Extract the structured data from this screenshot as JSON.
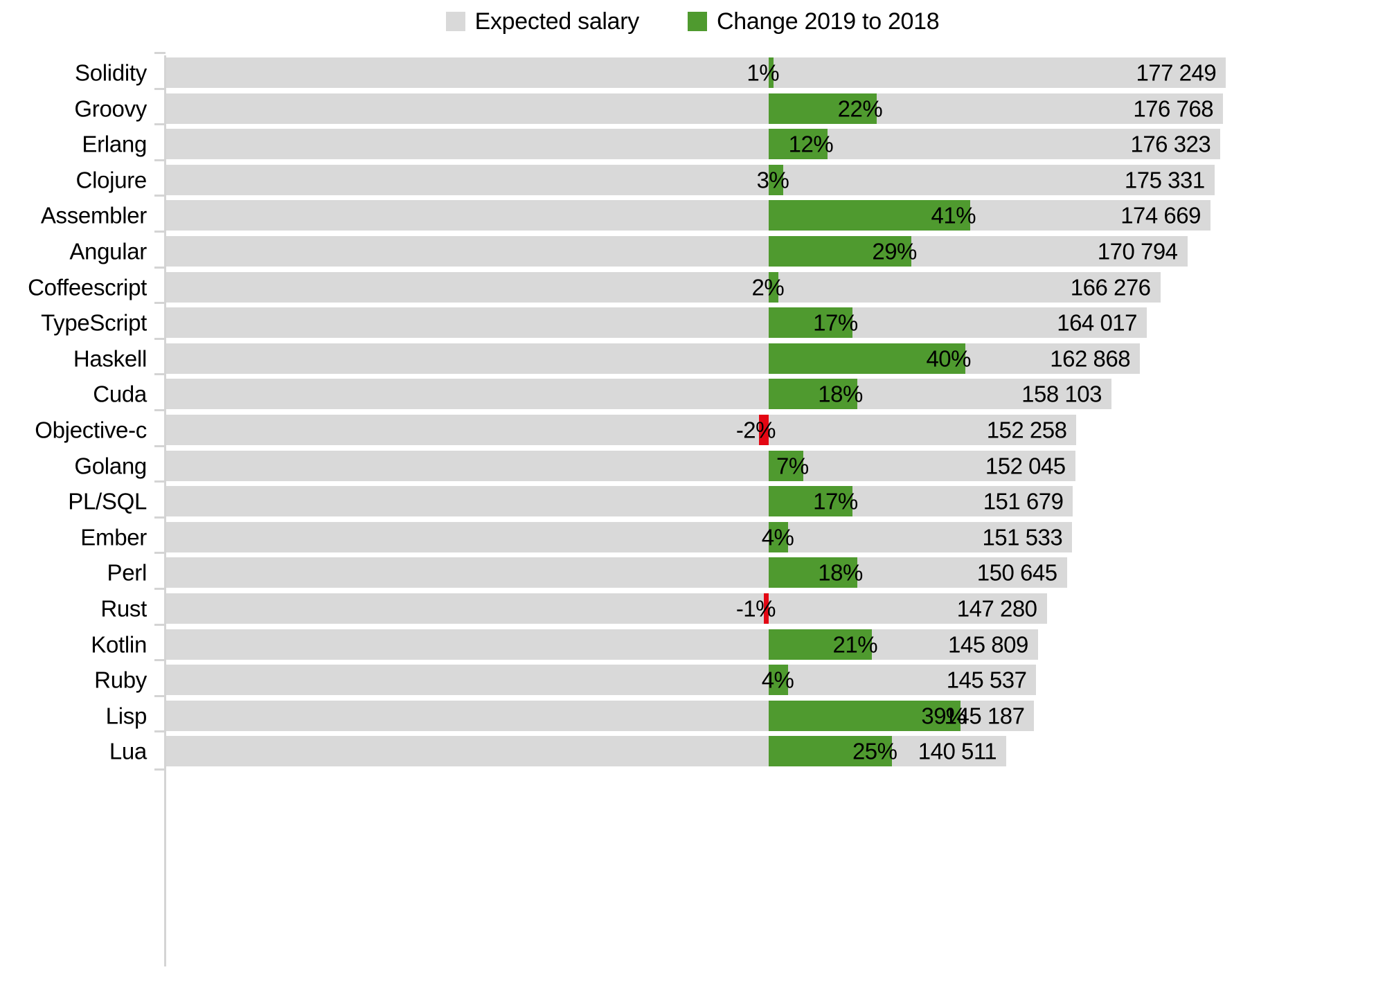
{
  "legend": {
    "items": [
      {
        "label": "Expected salary",
        "color": "#d9d9d9",
        "swatch_name": "legend-swatch-expected-salary"
      },
      {
        "label": "Change 2019 to 2018",
        "color": "#4f9a2f",
        "swatch_name": "legend-swatch-change"
      }
    ]
  },
  "colors": {
    "expected_salary_bar": "#d9d9d9",
    "positive_change_bar": "#4f9a2f",
    "negative_change_bar": "#e30613",
    "axis": "#d4d4d4",
    "text": "#000000",
    "background": "#ffffff"
  },
  "chart_data": {
    "type": "bar",
    "orientation": "horizontal",
    "title": "",
    "subtitle": "",
    "xlabel": "",
    "ylabel": "",
    "grid": false,
    "legend_position": "top-center",
    "categories": [
      "Solidity",
      "Groovy",
      "Erlang",
      "Clojure",
      "Assembler",
      "Angular",
      "Coffeescript",
      "TypeScript",
      "Haskell",
      "Cuda",
      "Objective-c",
      "Golang",
      "PL/SQL",
      "Ember",
      "Perl",
      "Rust",
      "Kotlin",
      "Ruby",
      "Lisp",
      "Lua"
    ],
    "series": [
      {
        "name": "Expected salary",
        "color": "#d9d9d9",
        "values": [
          177249,
          176768,
          176323,
          175331,
          174669,
          170794,
          166276,
          164017,
          162868,
          158103,
          152258,
          152045,
          151679,
          151533,
          150645,
          147280,
          145809,
          145537,
          145187,
          140511
        ],
        "labels": [
          "177 249",
          "176 768",
          "176 323",
          "175 331",
          "174 669",
          "170 794",
          "166 276",
          "164 017",
          "162 868",
          "158 103",
          "152 258",
          "152 045",
          "151 679",
          "151 533",
          "150 645",
          "147 280",
          "145 809",
          "145 537",
          "145 187",
          "140 511"
        ]
      },
      {
        "name": "Change 2019 to 2018",
        "color": "#4f9a2f",
        "negative_color": "#e30613",
        "values": [
          1,
          22,
          12,
          3,
          41,
          29,
          2,
          17,
          40,
          18,
          -2,
          7,
          17,
          4,
          18,
          -1,
          21,
          4,
          39,
          25
        ],
        "labels": [
          "1%",
          "22%",
          "12%",
          "3%",
          "41%",
          "29%",
          "2%",
          "17%",
          "40%",
          "18%",
          "-2%",
          "7%",
          "17%",
          "4%",
          "18%",
          "-1%",
          "21%",
          "4%",
          "39%",
          "25%"
        ]
      }
    ],
    "salary_axis_max": 180000,
    "change_axis_range": [
      -5,
      45
    ]
  }
}
